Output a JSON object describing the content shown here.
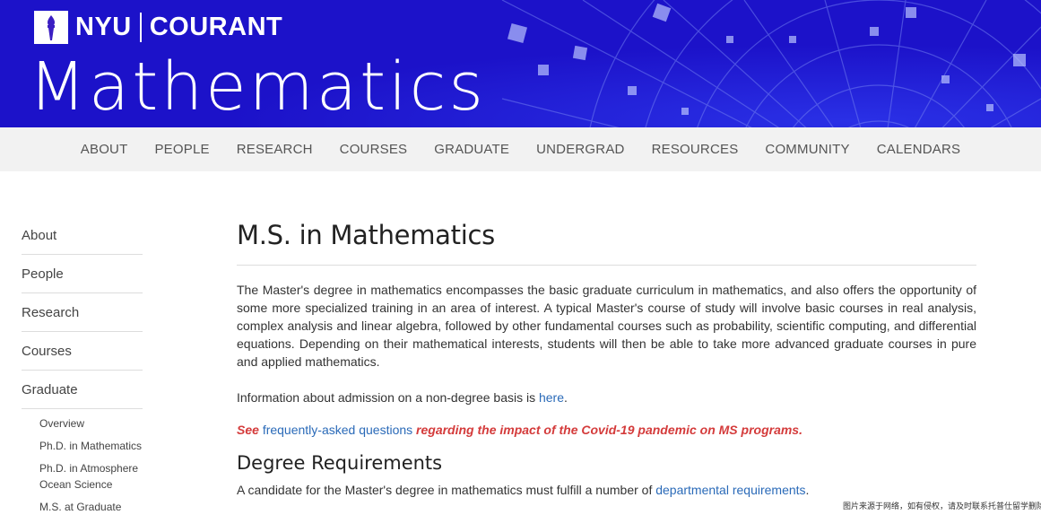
{
  "header": {
    "logo_nyu": "NYU",
    "logo_courant": "COURANT",
    "site_title": "Mathematics",
    "banner_color": "#1c12c9"
  },
  "nav": {
    "items": [
      "ABOUT",
      "PEOPLE",
      "RESEARCH",
      "COURSES",
      "GRADUATE",
      "UNDERGRAD",
      "RESOURCES",
      "COMMUNITY",
      "CALENDARS"
    ]
  },
  "sidebar": {
    "items": [
      "About",
      "People",
      "Research",
      "Courses",
      "Graduate"
    ],
    "subitems": [
      "Overview",
      "Ph.D. in Mathematics",
      "Ph.D. in Atmosphere Ocean Science",
      "M.S. at Graduate"
    ]
  },
  "main": {
    "title": "M.S. in Mathematics",
    "intro": "The Master's degree in mathematics encompasses the basic graduate curriculum in mathematics, and also offers the opportunity of some more specialized training in an area of interest.  A typical Master's course of study will involve basic courses in real analysis, complex analysis and linear algebra, followed by other fundamental courses such as probability, scientific computing, and differential equations. Depending on their mathematical interests, students will then be able to take more advanced graduate courses in pure and applied mathematics.",
    "admission_text": "Information about admission on a non-degree basis is ",
    "admission_link": "here",
    "admission_end": ".",
    "covid_see": "See ",
    "covid_link": "frequently-asked questions",
    "covid_text": " regarding the impact of the Covid-19 pandemic on MS programs.",
    "requirements_heading": "Degree Requirements",
    "requirements_text": "A candidate for the Master's degree in mathematics must fulfill a number of ",
    "requirements_link": "departmental requirements",
    "requirements_end": "."
  },
  "watermark": "图片来源于网络，如有侵权，请及时联系托普仕留学删除"
}
